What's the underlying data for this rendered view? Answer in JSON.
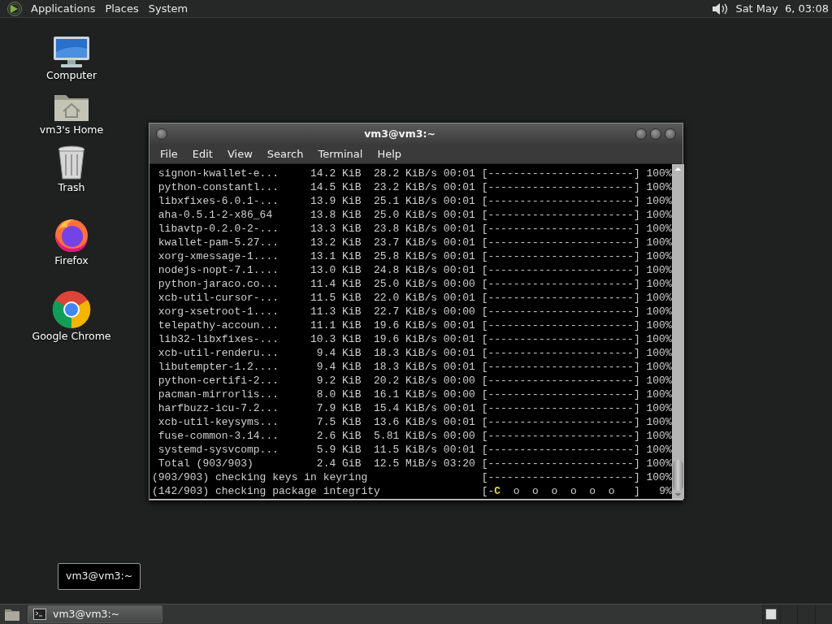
{
  "top_panel": {
    "menus": [
      "Applications",
      "Places",
      "System"
    ],
    "clock": "Sat May  6, 03:08"
  },
  "desktop_icons": [
    {
      "label": "Computer",
      "kind": "computer"
    },
    {
      "label": "vm3's Home",
      "kind": "home"
    },
    {
      "label": "Trash",
      "kind": "trash"
    },
    {
      "label": "Firefox",
      "kind": "firefox"
    },
    {
      "label": "Google Chrome",
      "kind": "chrome"
    }
  ],
  "terminal": {
    "title": "vm3@vm3:~",
    "menu": [
      "File",
      "Edit",
      "View",
      "Search",
      "Terminal",
      "Help"
    ],
    "lines": [
      {
        "kind": "plain",
        "text": " signon-kwallet-e...     14.2 KiB  28.2 KiB/s 00:01 [-----------------------] 100%"
      },
      {
        "kind": "plain",
        "text": " python-constantl...     14.5 KiB  23.2 KiB/s 00:01 [-----------------------] 100%"
      },
      {
        "kind": "plain",
        "text": " libxfixes-6.0.1-...     13.9 KiB  25.1 KiB/s 00:01 [-----------------------] 100%"
      },
      {
        "kind": "plain",
        "text": " aha-0.5.1-2-x86_64      13.8 KiB  25.0 KiB/s 00:01 [-----------------------] 100%"
      },
      {
        "kind": "plain",
        "text": " libavtp-0.2.0-2-...     13.3 KiB  23.8 KiB/s 00:01 [-----------------------] 100%"
      },
      {
        "kind": "plain",
        "text": " kwallet-pam-5.27...     13.2 KiB  23.7 KiB/s 00:01 [-----------------------] 100%"
      },
      {
        "kind": "plain",
        "text": " xorg-xmessage-1....     13.1 KiB  25.8 KiB/s 00:01 [-----------------------] 100%"
      },
      {
        "kind": "plain",
        "text": " nodejs-nopt-7.1....     13.0 KiB  24.8 KiB/s 00:01 [-----------------------] 100%"
      },
      {
        "kind": "plain",
        "text": " python-jaraco.co...     11.4 KiB  25.0 KiB/s 00:00 [-----------------------] 100%"
      },
      {
        "kind": "plain",
        "text": " xcb-util-cursor-...     11.5 KiB  22.0 KiB/s 00:01 [-----------------------] 100%"
      },
      {
        "kind": "plain",
        "text": " xorg-xsetroot-1....     11.3 KiB  22.7 KiB/s 00:00 [-----------------------] 100%"
      },
      {
        "kind": "plain",
        "text": " telepathy-accoun...     11.1 KiB  19.6 KiB/s 00:01 [-----------------------] 100%"
      },
      {
        "kind": "plain",
        "text": " lib32-libxfixes-...     10.3 KiB  19.6 KiB/s 00:01 [-----------------------] 100%"
      },
      {
        "kind": "plain",
        "text": " xcb-util-renderu...      9.4 KiB  18.3 KiB/s 00:01 [-----------------------] 100%"
      },
      {
        "kind": "plain",
        "text": " libutempter-1.2....      9.4 KiB  18.3 KiB/s 00:01 [-----------------------] 100%"
      },
      {
        "kind": "plain",
        "text": " python-certifi-2...      9.2 KiB  20.2 KiB/s 00:00 [-----------------------] 100%"
      },
      {
        "kind": "plain",
        "text": " pacman-mirrorlis...      8.0 KiB  16.1 KiB/s 00:00 [-----------------------] 100%"
      },
      {
        "kind": "plain",
        "text": " harfbuzz-icu-7.2...      7.9 KiB  15.4 KiB/s 00:01 [-----------------------] 100%"
      },
      {
        "kind": "plain",
        "text": " xcb-util-keysyms...      7.5 KiB  13.6 KiB/s 00:01 [-----------------------] 100%"
      },
      {
        "kind": "plain",
        "text": " fuse-common-3.14...      2.6 KiB  5.81 KiB/s 00:00 [-----------------------] 100%"
      },
      {
        "kind": "plain",
        "text": " systemd-sysvcomp...      5.9 KiB  11.5 KiB/s 00:01 [-----------------------] 100%"
      },
      {
        "kind": "plain",
        "text": " Total (903/903)          2.4 GiB  12.5 MiB/s 03:20 [-----------------------] 100%"
      },
      {
        "kind": "plain",
        "text": "(903/903) checking keys in keyring                  [-----------------------] 100%"
      },
      {
        "kind": "pacman",
        "before": "(142/903) checking package integrity                [-",
        "pacman": "C",
        "after": "  o  o  o  o  o  o   ]   9%"
      }
    ]
  },
  "tooltip": "vm3@vm3:~",
  "taskbar": {
    "tasks": [
      {
        "label": "vm3@vm3:~",
        "selected": true
      }
    ]
  }
}
